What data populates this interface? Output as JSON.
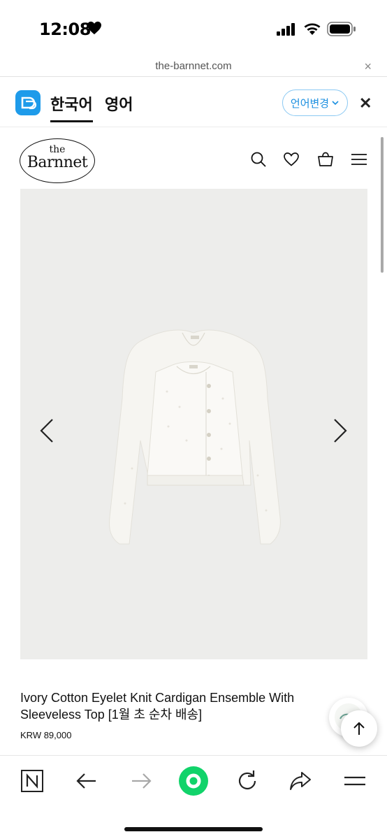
{
  "status_bar": {
    "time": "12:08",
    "icons": [
      "heart-icon",
      "cellular-signal-icon",
      "wifi-icon",
      "battery-icon"
    ]
  },
  "browser": {
    "url": "the-barnnet.com",
    "close_icon": "×"
  },
  "translation_bar": {
    "languages": [
      "한국어",
      "영어"
    ],
    "active_language": "한국어",
    "change_button": "언어변경",
    "close_icon": "✕",
    "accent_color": "#1e9bea"
  },
  "site_header": {
    "logo_the": "the",
    "logo_brand": "Barnnet",
    "icons": [
      "search-icon",
      "heart-icon",
      "cart-icon",
      "menu-icon"
    ]
  },
  "product": {
    "title": "Ivory Cotton Eyelet Knit Cardigan Ensemble With Sleeveless Top [1월 초 순차 배송]",
    "price": "KRW 89,000",
    "image_background": "#ededeb"
  },
  "toolbar": {
    "items": [
      "naver-n-icon",
      "back-arrow-icon",
      "forward-arrow-icon",
      "green-dot-home-icon",
      "reload-icon",
      "share-icon",
      "menu-icon"
    ],
    "accent_color": "#11d36a"
  }
}
